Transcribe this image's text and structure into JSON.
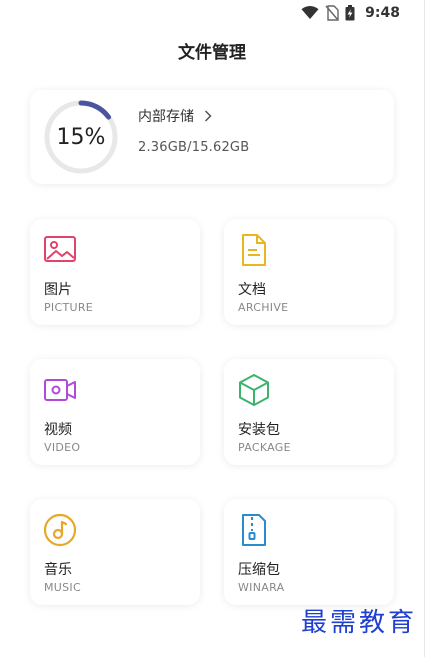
{
  "status_bar": {
    "time": "9:48",
    "icons": [
      "wifi-icon",
      "no-sim-icon",
      "battery-charging-icon"
    ]
  },
  "header": {
    "title": "文件管理"
  },
  "storage": {
    "percent_label": "15%",
    "percent_value": 15,
    "name": "内部存储",
    "usage": "2.36GB/15.62GB",
    "ring_color": "#4a55a2",
    "ring_track_color": "#e8e8e8"
  },
  "categories": [
    {
      "label": "图片",
      "sublabel": "PICTURE",
      "icon": "picture-icon",
      "color": "#e0446a"
    },
    {
      "label": "文档",
      "sublabel": "ARCHIVE",
      "icon": "document-icon",
      "color": "#e8b71f"
    },
    {
      "label": "视频",
      "sublabel": "VIDEO",
      "icon": "video-icon",
      "color": "#b24ad8"
    },
    {
      "label": "安装包",
      "sublabel": "PACKAGE",
      "icon": "package-icon",
      "color": "#3bb36a"
    },
    {
      "label": "音乐",
      "sublabel": "MUSIC",
      "icon": "music-icon",
      "color": "#e5a92a"
    },
    {
      "label": "压缩包",
      "sublabel": "WINARA",
      "icon": "zip-icon",
      "color": "#2a8ccf"
    }
  ],
  "watermark": "最需教育"
}
